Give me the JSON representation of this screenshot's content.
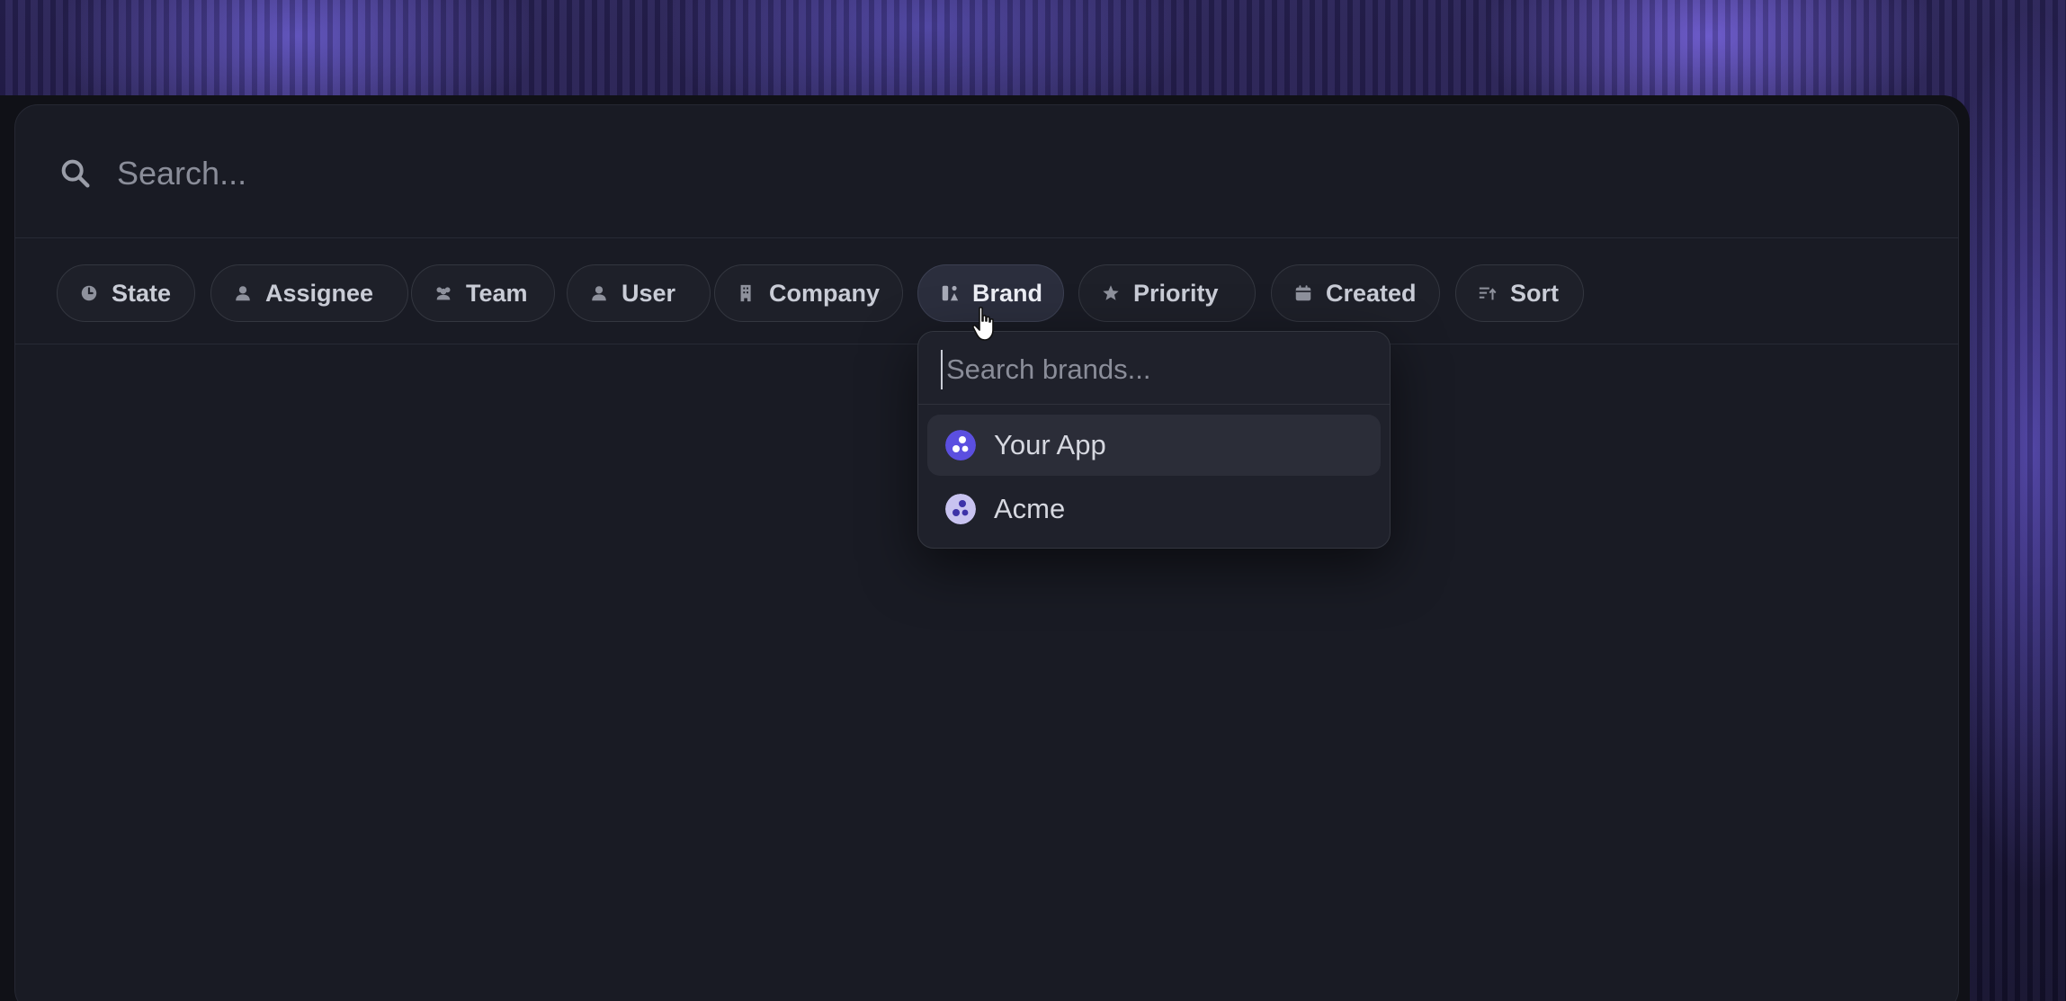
{
  "search": {
    "placeholder": "Search...",
    "icon": "search-icon"
  },
  "filters": [
    {
      "label": "State",
      "icon": "clock-icon"
    },
    {
      "label": "Assignee",
      "icon": "person-icon"
    },
    {
      "label": "Team",
      "icon": "people-icon"
    },
    {
      "label": "User",
      "icon": "person-icon"
    },
    {
      "label": "Company",
      "icon": "building-icon"
    },
    {
      "label": "Brand",
      "icon": "brand-icon",
      "active": true
    },
    {
      "label": "Priority",
      "icon": "star-icon"
    },
    {
      "label": "Created",
      "icon": "calendar-icon"
    },
    {
      "label": "Sort",
      "icon": "sort-icon"
    }
  ],
  "brand_dropdown": {
    "placeholder": "Search brands...",
    "items": [
      {
        "label": "Your App",
        "logo_color": "#5b4fe0",
        "highlighted": true
      },
      {
        "label": "Acme",
        "logo_color": "#c8c3f0",
        "highlighted": false
      }
    ]
  },
  "colors": {
    "panel_bg": "#191b24",
    "chip_bg": "#1e2029",
    "accent": "#5b4fe0"
  }
}
